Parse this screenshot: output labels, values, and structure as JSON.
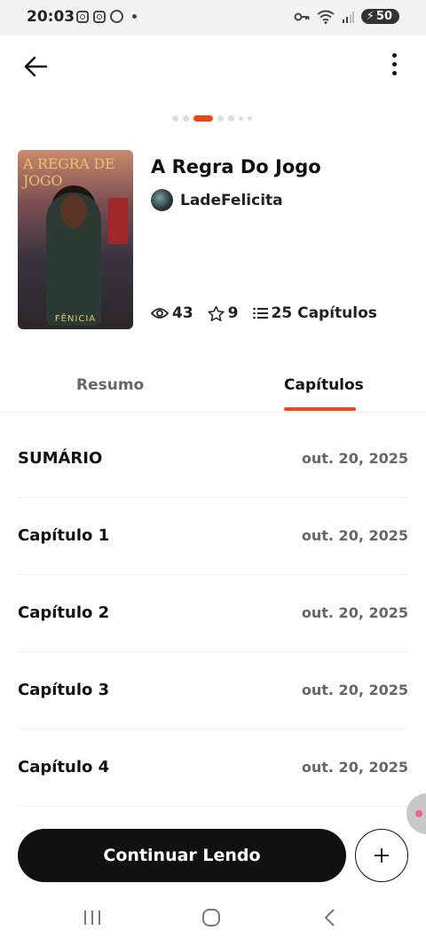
{
  "status_bar": {
    "time": "20:03",
    "battery": "50",
    "left_icons": [
      "instagram-icon",
      "instagram-icon",
      "whatsapp-icon",
      "notification-dot-icon"
    ],
    "right_icons": [
      "vpn-key-icon",
      "wifi-icon",
      "signal-icon",
      "battery-icon"
    ]
  },
  "top_bar": {
    "back_icon": "arrow-left-icon",
    "menu_icon": "more-vertical-icon"
  },
  "pager": {
    "count": 7,
    "active_index": 2
  },
  "book": {
    "cover_title": "A REGRA DE JOGO",
    "cover_author": "FÊNICIA",
    "title": "A Regra Do Jogo",
    "author": "LadeFelicita",
    "views": "43",
    "stars": "9",
    "chapters_label": "25 Capítulos"
  },
  "tabs": [
    {
      "label": "Resumo",
      "active": false
    },
    {
      "label": "Capítulos",
      "active": true
    }
  ],
  "chapters": [
    {
      "title": "SUMÁRIO",
      "date": "out. 20, 2025"
    },
    {
      "title": "Capítulo 1",
      "date": "out. 20, 2025"
    },
    {
      "title": "Capítulo 2",
      "date": "out. 20, 2025"
    },
    {
      "title": "Capítulo 3",
      "date": "out. 20, 2025"
    },
    {
      "title": "Capítulo 4",
      "date": "out. 20, 2025"
    }
  ],
  "actions": {
    "continue_label": "Continuar Lendo",
    "add_icon": "plus-icon"
  },
  "colors": {
    "accent": "#e64a19",
    "button_dark": "#111111",
    "status_bar_bg": "#f2f2f2"
  }
}
